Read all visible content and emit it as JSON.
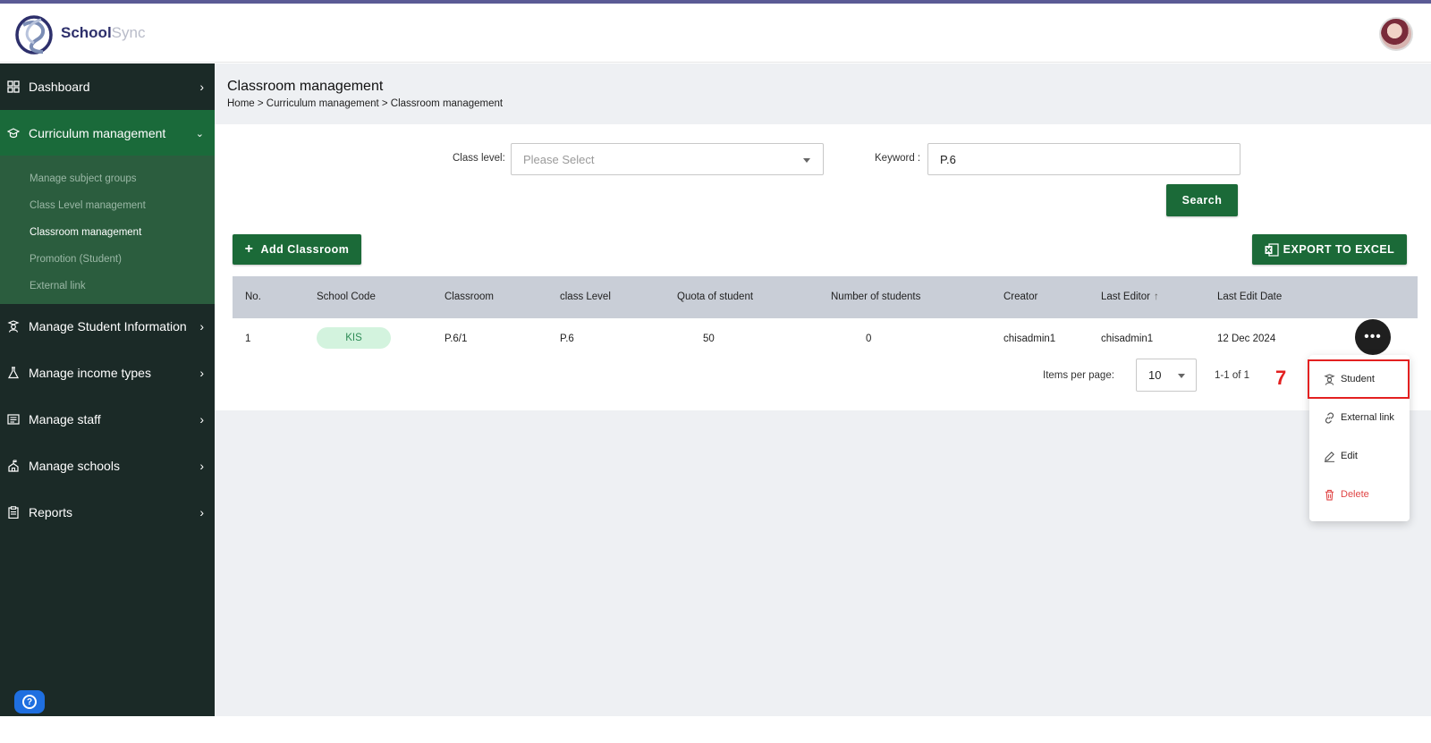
{
  "app": {
    "brand_primary": "School",
    "brand_secondary": "Sync"
  },
  "colors": {
    "sidebar_bg": "#1b2a27",
    "active_nav": "#1a6a3a",
    "submenu_bg": "#2b5d3e",
    "primary_button": "#1b6a38",
    "accent_bar": "#5b5b95",
    "highlight": "#e32020"
  },
  "sidebar": {
    "items": [
      {
        "label": "Dashboard",
        "icon": "grid-icon"
      },
      {
        "label": "Curriculum management",
        "icon": "graduation-cap-icon"
      },
      {
        "label": "Manage Student Information",
        "icon": "student-icon"
      },
      {
        "label": "Manage income types",
        "icon": "flask-icon"
      },
      {
        "label": "Manage staff",
        "icon": "id-card-icon"
      },
      {
        "label": "Manage schools",
        "icon": "school-icon"
      },
      {
        "label": "Reports",
        "icon": "clipboard-icon"
      }
    ],
    "submenu": [
      "Manage subject groups",
      "Class Level management",
      "Classroom management",
      "Promotion (Student)",
      "External link"
    ]
  },
  "page": {
    "title": "Classroom management",
    "breadcrumb": "Home > Curriculum management > Classroom management"
  },
  "filters": {
    "class_level_label": "Class level:",
    "class_level_placeholder": "Please Select",
    "keyword_label": "Keyword :",
    "keyword_value": "P.6",
    "search_label": "Search"
  },
  "actions": {
    "add_label": "Add Classroom",
    "export_label": "EXPORT TO EXCEL"
  },
  "table": {
    "headers": [
      "No.",
      "School Code",
      "Classroom",
      "class Level",
      "Quota of student",
      "Number of students",
      "Creator",
      "Last Editor",
      "Last Edit Date"
    ],
    "rows": [
      {
        "no": "1",
        "school_code": "KIS",
        "classroom": "P.6/1",
        "class_level": "P.6",
        "quota": "50",
        "students": "0",
        "creator": "chisadmin1",
        "last_editor": "chisadmin1",
        "last_edit_date": "12 Dec 2024"
      }
    ]
  },
  "pagination": {
    "items_per_page_label": "Items per page:",
    "items_per_page_value": "10",
    "range": "1-1 of 1"
  },
  "row_menu": {
    "items": [
      {
        "label": "Student",
        "icon": "student-icon"
      },
      {
        "label": "External link",
        "icon": "link-icon"
      },
      {
        "label": "Edit",
        "icon": "pencil-icon"
      },
      {
        "label": "Delete",
        "icon": "trash-icon"
      }
    ]
  },
  "annotation": {
    "step": "7"
  }
}
